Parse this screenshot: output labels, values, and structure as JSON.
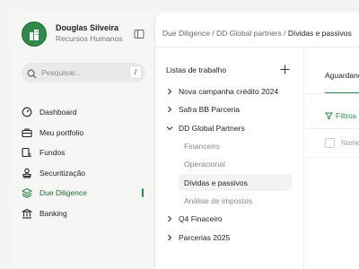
{
  "profile": {
    "name": "Douglas Silveira",
    "role": "Recursos Humanos"
  },
  "search": {
    "placeholder": "Pesquisar...",
    "shortcut": "/"
  },
  "nav": {
    "items": [
      {
        "label": "Dashboard",
        "icon": "dashboard-icon"
      },
      {
        "label": "Meu portfolio",
        "icon": "briefcase-icon"
      },
      {
        "label": "Fundos",
        "icon": "funds-icon"
      },
      {
        "label": "Securitização",
        "icon": "stamp-icon"
      },
      {
        "label": "Due Diligence",
        "icon": "layers-icon",
        "active": true
      },
      {
        "label": "Banking",
        "icon": "bank-icon"
      }
    ]
  },
  "breadcrumb": {
    "part1": "Due Diligence",
    "sep": " / ",
    "part2": "DD Global partners",
    "current": "Dívidas e passivos"
  },
  "worklist": {
    "title": "Listas de trabalho",
    "items": [
      {
        "label": "Nova campanha crédito 2024",
        "state": "collapsed"
      },
      {
        "label": "Safra BB Parceria",
        "state": "collapsed"
      },
      {
        "label": "DD Global Partners",
        "state": "expanded"
      },
      {
        "label": "Financeiro",
        "child": true
      },
      {
        "label": "Operacional",
        "child": true
      },
      {
        "label": "Dívidas e passivos",
        "child": true,
        "selected": true
      },
      {
        "label": "Análise de impostos",
        "child": true
      },
      {
        "label": "Q4 Finaceiro",
        "state": "collapsed"
      },
      {
        "label": "Parcerias 2025",
        "state": "collapsed"
      }
    ]
  },
  "right_pane": {
    "tab": "Aguardando",
    "filter": "Filtros",
    "column_name": "Nome"
  },
  "colors": {
    "accent": "#2f8a4a",
    "sidebar_bg": "#f6f6f4",
    "main_bg": "#ffffff"
  }
}
